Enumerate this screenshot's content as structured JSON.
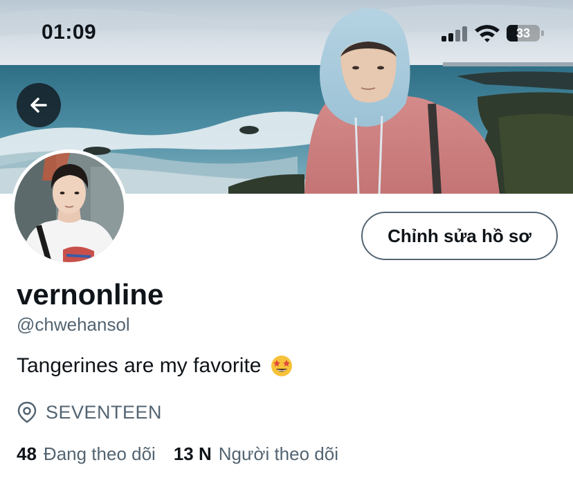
{
  "status_bar": {
    "time": "01:09",
    "battery": "33",
    "battery_level": 0.33
  },
  "profile": {
    "display_name": "vernonline",
    "handle": "@chwehansol",
    "bio": "Tangerines are my favorite",
    "bio_emoji": "star-struck-emoji",
    "location": "SEVENTEEN",
    "edit_profile_label": "Chỉnh sửa hồ sơ"
  },
  "stats": {
    "following_count": "48",
    "following_label": "Đang theo dõi",
    "followers_count": "13 N",
    "followers_label": "Người theo dõi"
  },
  "icons": {
    "back": "arrow-left-icon",
    "location": "location-pin-icon",
    "signal": "cellular-signal-icon",
    "wifi": "wifi-icon",
    "battery": "battery-icon"
  },
  "colors": {
    "text_primary": "#0f1419",
    "text_secondary": "#536471",
    "button_border": "#536471"
  }
}
